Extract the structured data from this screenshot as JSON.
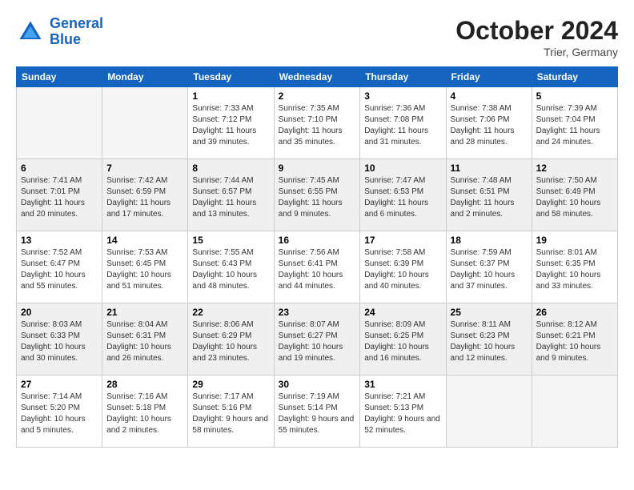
{
  "logo": {
    "line1": "General",
    "line2": "Blue"
  },
  "title": "October 2024",
  "location": "Trier, Germany",
  "days_of_week": [
    "Sunday",
    "Monday",
    "Tuesday",
    "Wednesday",
    "Thursday",
    "Friday",
    "Saturday"
  ],
  "weeks": [
    [
      {
        "day": null
      },
      {
        "day": null
      },
      {
        "day": "1",
        "sunrise": "Sunrise: 7:33 AM",
        "sunset": "Sunset: 7:12 PM",
        "daylight": "Daylight: 11 hours and 39 minutes."
      },
      {
        "day": "2",
        "sunrise": "Sunrise: 7:35 AM",
        "sunset": "Sunset: 7:10 PM",
        "daylight": "Daylight: 11 hours and 35 minutes."
      },
      {
        "day": "3",
        "sunrise": "Sunrise: 7:36 AM",
        "sunset": "Sunset: 7:08 PM",
        "daylight": "Daylight: 11 hours and 31 minutes."
      },
      {
        "day": "4",
        "sunrise": "Sunrise: 7:38 AM",
        "sunset": "Sunset: 7:06 PM",
        "daylight": "Daylight: 11 hours and 28 minutes."
      },
      {
        "day": "5",
        "sunrise": "Sunrise: 7:39 AM",
        "sunset": "Sunset: 7:04 PM",
        "daylight": "Daylight: 11 hours and 24 minutes."
      }
    ],
    [
      {
        "day": "6",
        "sunrise": "Sunrise: 7:41 AM",
        "sunset": "Sunset: 7:01 PM",
        "daylight": "Daylight: 11 hours and 20 minutes."
      },
      {
        "day": "7",
        "sunrise": "Sunrise: 7:42 AM",
        "sunset": "Sunset: 6:59 PM",
        "daylight": "Daylight: 11 hours and 17 minutes."
      },
      {
        "day": "8",
        "sunrise": "Sunrise: 7:44 AM",
        "sunset": "Sunset: 6:57 PM",
        "daylight": "Daylight: 11 hours and 13 minutes."
      },
      {
        "day": "9",
        "sunrise": "Sunrise: 7:45 AM",
        "sunset": "Sunset: 6:55 PM",
        "daylight": "Daylight: 11 hours and 9 minutes."
      },
      {
        "day": "10",
        "sunrise": "Sunrise: 7:47 AM",
        "sunset": "Sunset: 6:53 PM",
        "daylight": "Daylight: 11 hours and 6 minutes."
      },
      {
        "day": "11",
        "sunrise": "Sunrise: 7:48 AM",
        "sunset": "Sunset: 6:51 PM",
        "daylight": "Daylight: 11 hours and 2 minutes."
      },
      {
        "day": "12",
        "sunrise": "Sunrise: 7:50 AM",
        "sunset": "Sunset: 6:49 PM",
        "daylight": "Daylight: 10 hours and 58 minutes."
      }
    ],
    [
      {
        "day": "13",
        "sunrise": "Sunrise: 7:52 AM",
        "sunset": "Sunset: 6:47 PM",
        "daylight": "Daylight: 10 hours and 55 minutes."
      },
      {
        "day": "14",
        "sunrise": "Sunrise: 7:53 AM",
        "sunset": "Sunset: 6:45 PM",
        "daylight": "Daylight: 10 hours and 51 minutes."
      },
      {
        "day": "15",
        "sunrise": "Sunrise: 7:55 AM",
        "sunset": "Sunset: 6:43 PM",
        "daylight": "Daylight: 10 hours and 48 minutes."
      },
      {
        "day": "16",
        "sunrise": "Sunrise: 7:56 AM",
        "sunset": "Sunset: 6:41 PM",
        "daylight": "Daylight: 10 hours and 44 minutes."
      },
      {
        "day": "17",
        "sunrise": "Sunrise: 7:58 AM",
        "sunset": "Sunset: 6:39 PM",
        "daylight": "Daylight: 10 hours and 40 minutes."
      },
      {
        "day": "18",
        "sunrise": "Sunrise: 7:59 AM",
        "sunset": "Sunset: 6:37 PM",
        "daylight": "Daylight: 10 hours and 37 minutes."
      },
      {
        "day": "19",
        "sunrise": "Sunrise: 8:01 AM",
        "sunset": "Sunset: 6:35 PM",
        "daylight": "Daylight: 10 hours and 33 minutes."
      }
    ],
    [
      {
        "day": "20",
        "sunrise": "Sunrise: 8:03 AM",
        "sunset": "Sunset: 6:33 PM",
        "daylight": "Daylight: 10 hours and 30 minutes."
      },
      {
        "day": "21",
        "sunrise": "Sunrise: 8:04 AM",
        "sunset": "Sunset: 6:31 PM",
        "daylight": "Daylight: 10 hours and 26 minutes."
      },
      {
        "day": "22",
        "sunrise": "Sunrise: 8:06 AM",
        "sunset": "Sunset: 6:29 PM",
        "daylight": "Daylight: 10 hours and 23 minutes."
      },
      {
        "day": "23",
        "sunrise": "Sunrise: 8:07 AM",
        "sunset": "Sunset: 6:27 PM",
        "daylight": "Daylight: 10 hours and 19 minutes."
      },
      {
        "day": "24",
        "sunrise": "Sunrise: 8:09 AM",
        "sunset": "Sunset: 6:25 PM",
        "daylight": "Daylight: 10 hours and 16 minutes."
      },
      {
        "day": "25",
        "sunrise": "Sunrise: 8:11 AM",
        "sunset": "Sunset: 6:23 PM",
        "daylight": "Daylight: 10 hours and 12 minutes."
      },
      {
        "day": "26",
        "sunrise": "Sunrise: 8:12 AM",
        "sunset": "Sunset: 6:21 PM",
        "daylight": "Daylight: 10 hours and 9 minutes."
      }
    ],
    [
      {
        "day": "27",
        "sunrise": "Sunrise: 7:14 AM",
        "sunset": "Sunset: 5:20 PM",
        "daylight": "Daylight: 10 hours and 5 minutes."
      },
      {
        "day": "28",
        "sunrise": "Sunrise: 7:16 AM",
        "sunset": "Sunset: 5:18 PM",
        "daylight": "Daylight: 10 hours and 2 minutes."
      },
      {
        "day": "29",
        "sunrise": "Sunrise: 7:17 AM",
        "sunset": "Sunset: 5:16 PM",
        "daylight": "Daylight: 9 hours and 58 minutes."
      },
      {
        "day": "30",
        "sunrise": "Sunrise: 7:19 AM",
        "sunset": "Sunset: 5:14 PM",
        "daylight": "Daylight: 9 hours and 55 minutes."
      },
      {
        "day": "31",
        "sunrise": "Sunrise: 7:21 AM",
        "sunset": "Sunset: 5:13 PM",
        "daylight": "Daylight: 9 hours and 52 minutes."
      },
      {
        "day": null
      },
      {
        "day": null
      }
    ]
  ]
}
